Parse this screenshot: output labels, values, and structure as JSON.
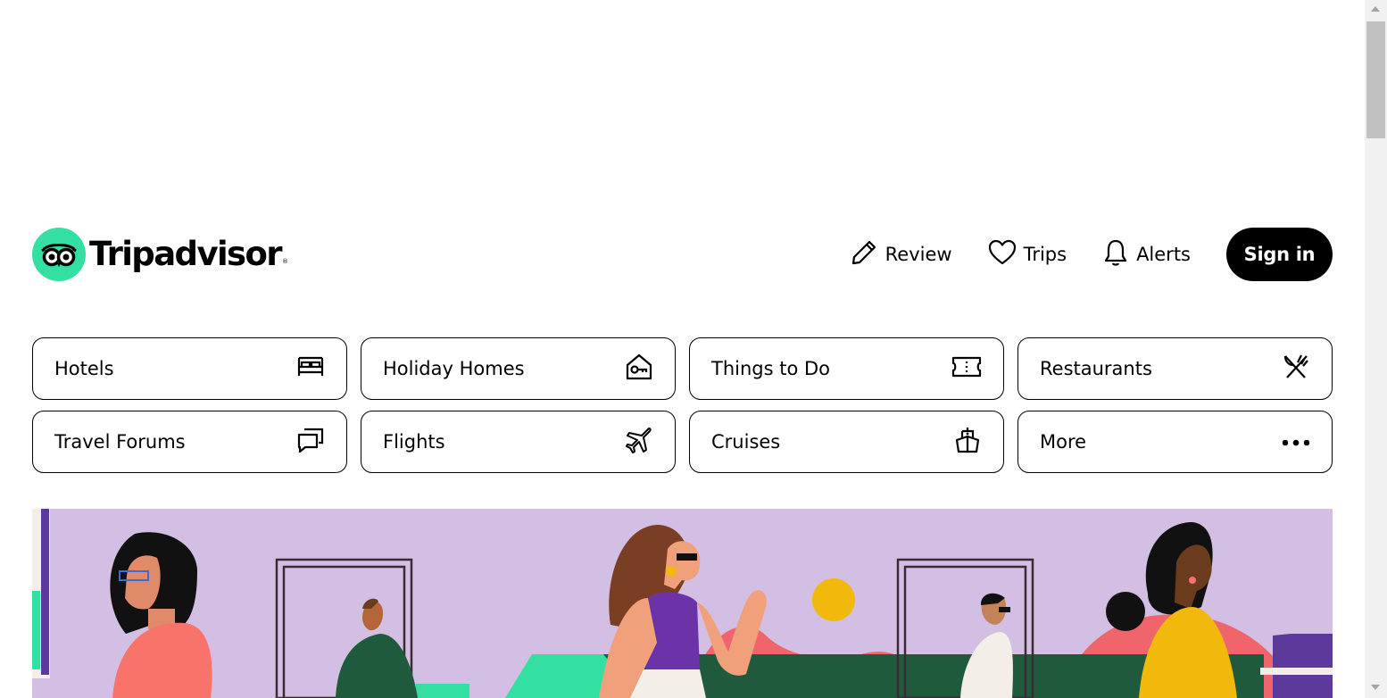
{
  "logo": {
    "text": "Tripadvisor",
    "reg": "®",
    "brand_color": "#34e0a1"
  },
  "nav": {
    "review": {
      "label": "Review",
      "icon": "pencil-icon"
    },
    "trips": {
      "label": "Trips",
      "icon": "heart-icon"
    },
    "alerts": {
      "label": "Alerts",
      "icon": "bell-icon"
    },
    "signin": {
      "label": "Sign in"
    }
  },
  "categories": [
    {
      "label": "Hotels",
      "icon": "bed-icon"
    },
    {
      "label": "Holiday Homes",
      "icon": "house-key-icon"
    },
    {
      "label": "Things to Do",
      "icon": "ticket-icon"
    },
    {
      "label": "Restaurants",
      "icon": "fork-knife-icon"
    },
    {
      "label": "Travel Forums",
      "icon": "chat-bubbles-icon"
    },
    {
      "label": "Flights",
      "icon": "plane-icon"
    },
    {
      "label": "Cruises",
      "icon": "ship-icon"
    },
    {
      "label": "More",
      "icon": "more-dots-icon"
    }
  ],
  "banner": {
    "background": "#d3bfe4",
    "description_icon": "people-walking-illustration"
  }
}
